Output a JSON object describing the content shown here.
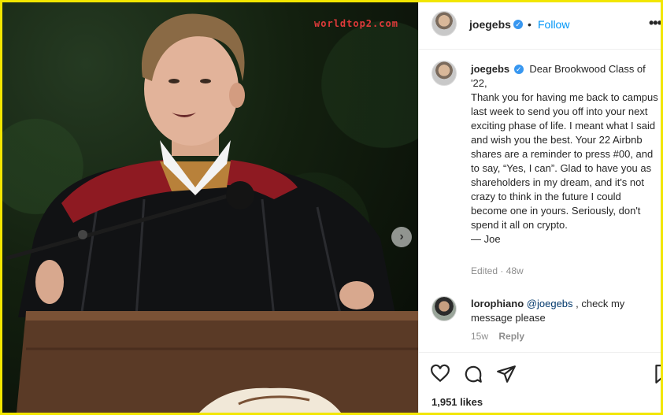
{
  "photo": {
    "watermark": "worldtop2.com",
    "next_arrow_icon": "chevron-right-icon"
  },
  "header": {
    "username": "joegebs",
    "separator": "•",
    "follow_label": "Follow",
    "more_label": "•••"
  },
  "post": {
    "username": "joegebs",
    "caption": "Dear Brookwood Class of '22,\nThank you for having me back to campus last week to send you off into your next exciting phase of life. I meant what I said and wish you the best. Your 22 Airbnb shares are a reminder to press #00, and to say, “Yes, I can”. Glad to have you as shareholders in my dream, and it's not crazy to think in the future I could become one in yours. Seriously, don't spend it all on crypto.\n— Joe",
    "edited": "Edited · 48w"
  },
  "comment": {
    "username": "lorophiano",
    "mention": "@joegebs",
    "text": " , check my message please",
    "age": "15w",
    "reply_label": "Reply"
  },
  "actions": {
    "icons": [
      "heart-icon",
      "comment-icon",
      "share-icon",
      "bookmark-icon"
    ]
  },
  "likes": "1,951 likes",
  "colors": {
    "accent": "#0095f6",
    "verified": "#3897f0",
    "frame": "#f2e600"
  }
}
